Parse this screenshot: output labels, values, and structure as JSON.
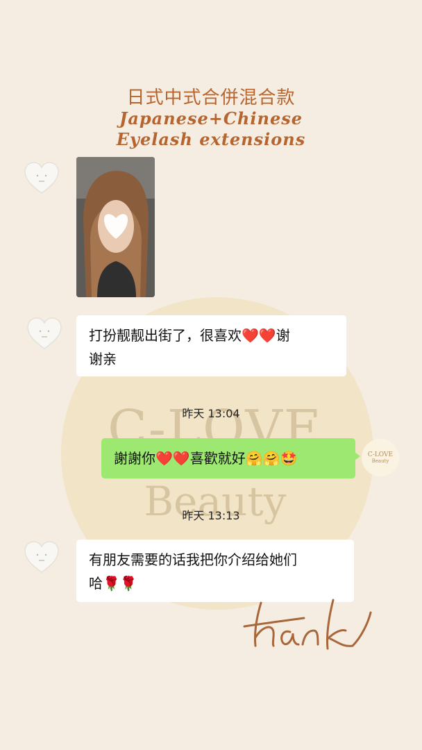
{
  "header": {
    "title_cn": "日式中式合併混合款",
    "title_en_line1": "Japanese+Chinese",
    "title_en_line2": "Eyelash extensions"
  },
  "watermark": {
    "brand": "C-LOVE",
    "sub": "Beauty"
  },
  "messages": [
    {
      "sender": "other",
      "type": "photo"
    },
    {
      "sender": "other",
      "type": "text",
      "lines": [
        "打扮靓靓出街了，很喜欢❤️❤️谢",
        "谢亲"
      ]
    },
    {
      "type": "timestamp",
      "text": "昨天 13:04"
    },
    {
      "sender": "me",
      "type": "text",
      "text": "謝謝你❤️❤️喜歡就好🤗🤗🤩"
    },
    {
      "type": "timestamp",
      "text": "昨天 13:13"
    },
    {
      "sender": "other",
      "type": "text",
      "lines": [
        "有朋友需要的话我把你介绍给她们",
        "哈🌹🌹"
      ]
    }
  ],
  "my_avatar": {
    "line1": "C-LOVE",
    "line2": "Beauty"
  },
  "icons": {
    "other_avatar": "heart-face-avatar-icon",
    "face_mask": "heart-face-mask-icon"
  },
  "colors": {
    "title": "#b7652e",
    "my_bubble": "#9de871",
    "other_bubble": "#ffffff",
    "background": "#f5ede2"
  }
}
